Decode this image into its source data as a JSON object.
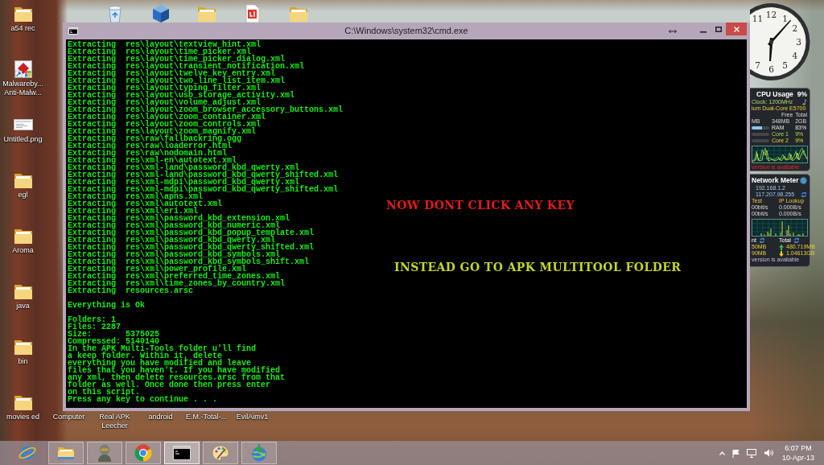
{
  "desktop": {
    "left_column": [
      {
        "kind": "folder",
        "label_lines": [
          "a54 rec"
        ]
      },
      {
        "kind": "app",
        "label_lines": [
          "Malwareby...",
          "Anti-Malw..."
        ]
      },
      {
        "kind": "image",
        "label_lines": [
          "Untitled.png"
        ]
      },
      {
        "kind": "folder",
        "label_lines": [
          "egl"
        ]
      },
      {
        "kind": "folder",
        "label_lines": [
          "Aroma"
        ]
      },
      {
        "kind": "folder",
        "label_lines": [
          "java"
        ]
      },
      {
        "kind": "folder",
        "label_lines": [
          "bin"
        ]
      },
      {
        "kind": "folder",
        "label_lines": [
          "movies ed"
        ]
      }
    ],
    "top_row": [
      {
        "kind": "recycle-bin"
      },
      {
        "kind": "cube"
      },
      {
        "kind": "folder"
      },
      {
        "kind": "document"
      },
      {
        "kind": "folder"
      }
    ],
    "bottom_row": [
      {
        "label_lines": [
          "Computer"
        ]
      },
      {
        "label_lines": [
          "Real APK",
          "Leecher"
        ]
      },
      {
        "label_lines": [
          "android"
        ]
      },
      {
        "label_lines": [
          "E.M.-Total-..."
        ]
      },
      {
        "label_lines": [
          "EvilAimv1"
        ]
      }
    ]
  },
  "console_window": {
    "title": "C:\\Windows\\system32\\cmd.exe",
    "extract_lines": [
      "Extracting  res\\layout\\textview_hint.xml",
      "Extracting  res\\layout\\time_picker.xml",
      "Extracting  res\\layout\\time_picker_dialog.xml",
      "Extracting  res\\layout\\transient_notification.xml",
      "Extracting  res\\layout\\twelve_key_entry.xml",
      "Extracting  res\\layout\\two_line_list_item.xml",
      "Extracting  res\\layout\\typing_filter.xml",
      "Extracting  res\\layout\\usb_storage_activity.xml",
      "Extracting  res\\layout\\volume_adjust.xml",
      "Extracting  res\\layout\\zoom_browser_accessory_buttons.xml",
      "Extracting  res\\layout\\zoom_container.xml",
      "Extracting  res\\layout\\zoom_controls.xml",
      "Extracting  res\\layout\\zoom_magnify.xml",
      "Extracting  res\\raw\\fallbackring.ogg",
      "Extracting  res\\raw\\loaderror.html",
      "Extracting  res\\raw\\nodomain.html",
      "Extracting  res\\xml-en\\autotext.xml",
      "Extracting  res\\xml-land\\password_kbd_qwerty.xml",
      "Extracting  res\\xml-land\\password_kbd_qwerty_shifted.xml",
      "Extracting  res\\xml-mdpi\\password_kbd_qwerty.xml",
      "Extracting  res\\xml-mdpi\\password_kbd_qwerty_shifted.xml",
      "Extracting  res\\xml\\apns.xml",
      "Extracting  res\\xml\\autotext.xml",
      "Extracting  res\\xml\\eri.xml",
      "Extracting  res\\xml\\password_kbd_extension.xml",
      "Extracting  res\\xml\\password_kbd_numeric.xml",
      "Extracting  res\\xml\\password_kbd_popup_template.xml",
      "Extracting  res\\xml\\password_kbd_qwerty.xml",
      "Extracting  res\\xml\\password_kbd_qwerty_shifted.xml",
      "Extracting  res\\xml\\password_kbd_symbols.xml",
      "Extracting  res\\xml\\password_kbd_symbols_shift.xml",
      "Extracting  res\\xml\\power_profile.xml",
      "Extracting  res\\xml\\preferred_time_zones.xml",
      "Extracting  res\\xml\\time_zones_by_country.xml",
      "Extracting  resources.arsc"
    ],
    "status": "Everything is Ok",
    "stats": [
      "Folders: 1",
      "Files: 2287",
      "Size:       5375025",
      "Compressed: 5140140"
    ],
    "message_lines": [
      "In the APK Multi-Tools folder u'll find",
      "a keep folder. Within it, delete",
      "everything you have modified and leave",
      "files that you haven't. If you have modified",
      "any xml, then delete resources.arsc from that",
      "folder as well. Once done then press enter",
      "on this script."
    ],
    "prompt": "Press any key to continue . . .",
    "notes": [
      {
        "text": "NOW DONT CLICK ANY KEY",
        "color": "#e31b1b"
      },
      {
        "text": "INSTEAD GO TO APK MULTITOOL FOLDER",
        "color": "#c5d629"
      }
    ]
  },
  "clock_gadget": {
    "numerals": [
      "11",
      "12",
      "1",
      "2",
      "3",
      "4",
      "5",
      "6",
      "7"
    ]
  },
  "cpu_gadget": {
    "title": "CPU Usage",
    "usage": "9%",
    "clock": "Clock: 1200MHz",
    "processor": "ium Dual-Core E5700",
    "memory_header": [
      "Free",
      "Total"
    ],
    "memory_values": [
      "MB",
      "348MB",
      "2GB"
    ],
    "meters": [
      {
        "label": "RAM",
        "value": "83%",
        "level": 0.6
      },
      {
        "label": "Core 1",
        "value": "9%"
      },
      {
        "label": "Core 2",
        "value": "9%"
      }
    ],
    "notice": "version is available"
  },
  "network_gadget": {
    "title": "Network Meter",
    "addresses": [
      "192.168.1.2",
      "117.207.98.255"
    ],
    "speed_header": [
      "Test",
      "IP Lookup"
    ],
    "speed_rows": [
      [
        "00bit/s",
        "0.000B/s"
      ],
      [
        "00bit/s",
        "0.000B/s"
      ]
    ],
    "totals_header": [
      "nt",
      "Total"
    ],
    "totals": [
      {
        "kind": "upload",
        "session": "50MB",
        "total": "480.719MB"
      },
      {
        "kind": "download",
        "session": "90MB",
        "total": "1.04613GB"
      }
    ],
    "notice": "version is available"
  },
  "taskbar": {
    "apps": [
      {
        "kind": "browser",
        "running": false,
        "selected": false
      },
      {
        "kind": "folder",
        "running": true,
        "selected": false
      },
      {
        "kind": "figure",
        "running": true,
        "selected": false
      },
      {
        "kind": "ring",
        "running": true,
        "selected": false
      },
      {
        "kind": "terminal",
        "running": true,
        "selected": true
      },
      {
        "kind": "palette",
        "running": true,
        "selected": false
      },
      {
        "kind": "globe",
        "running": true,
        "selected": false
      }
    ],
    "time": "6:07 PM",
    "date": "10-Apr-13"
  }
}
